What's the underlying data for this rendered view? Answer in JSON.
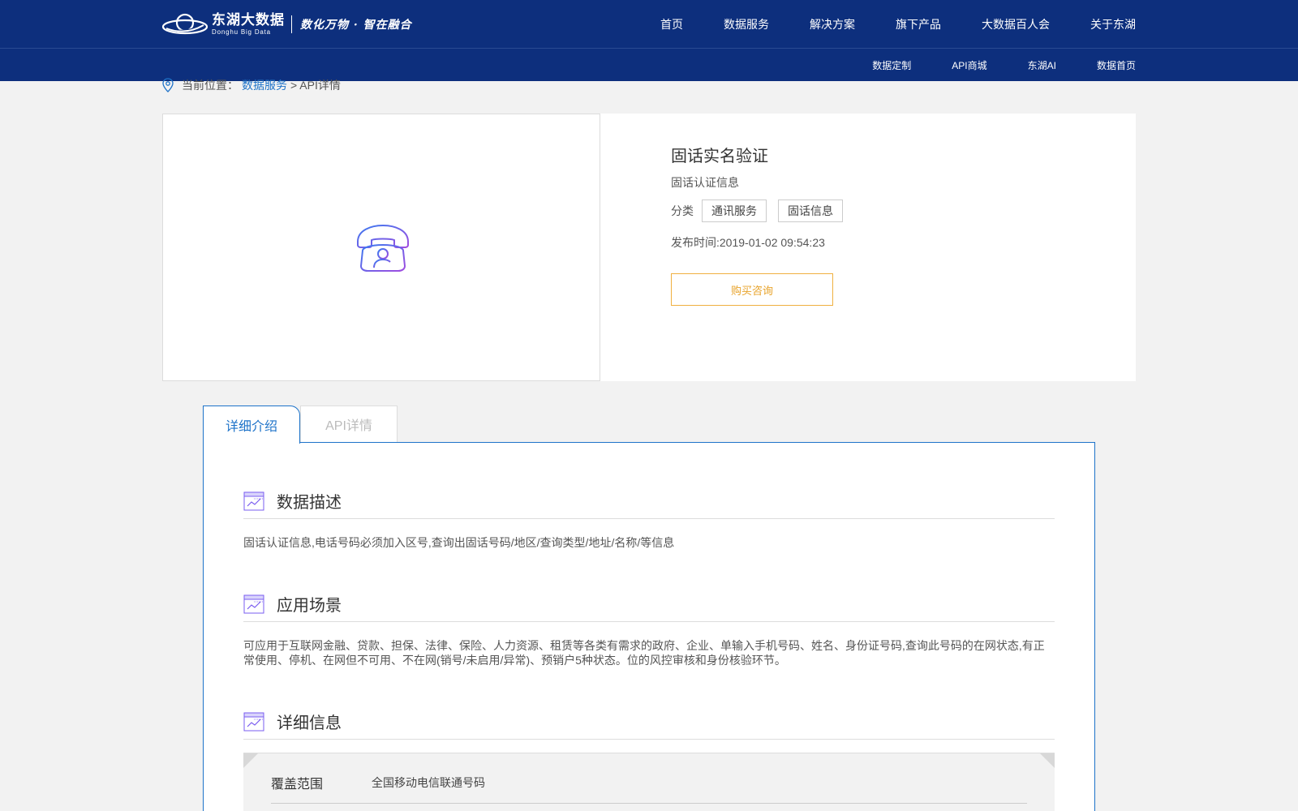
{
  "header": {
    "logo_cn": "东湖大数据",
    "logo_en": "Donghu Big Data",
    "slogan": "数化万物 · 智在融合",
    "nav": [
      "首页",
      "数据服务",
      "解决方案",
      "旗下产品",
      "大数据百人会",
      "关于东湖"
    ]
  },
  "subnav": [
    "数据定制",
    "API商城",
    "东湖AI",
    "数据首页"
  ],
  "breadcrumb": {
    "prefix": "当前位置：",
    "link": "数据服务",
    "rest": "> API详情"
  },
  "product": {
    "title": "固话实名验证",
    "subtitle": "固话认证信息",
    "category_label": "分类",
    "tags": [
      "通讯服务",
      "固话信息"
    ],
    "publish": "发布时间:2019-01-02 09:54:23",
    "buy_label": "购买咨询",
    "image_icon": "telephone-user-icon"
  },
  "tabs": [
    "详细介绍",
    "API详情"
  ],
  "sections": [
    {
      "title": "数据描述",
      "body": "固话认证信息,电话号码必须加入区号,查询出固话号码/地区/查询类型/地址/名称/等信息"
    },
    {
      "title": "应用场景",
      "body": "可应用于互联网金融、贷款、担保、法律、保险、人力资源、租赁等各类有需求的政府、企业、单输入手机号码、姓名、身份证号码,查询此号码的在网状态,有正常使用、停机、在网但不可用、不在网(销号/未启用/异常)、预销户5种状态。位的风控审核和身份核验环节。"
    },
    {
      "title": "详细信息",
      "body": ""
    }
  ],
  "details_table": [
    {
      "key": "覆盖范围",
      "value": "全国移动电信联通号码"
    }
  ],
  "colors": {
    "header_bg": "#0d2f7d",
    "accent_blue": "#1e73c9",
    "buy_orange": "#e8a32a",
    "icon_purple": "#7a5cf0"
  }
}
